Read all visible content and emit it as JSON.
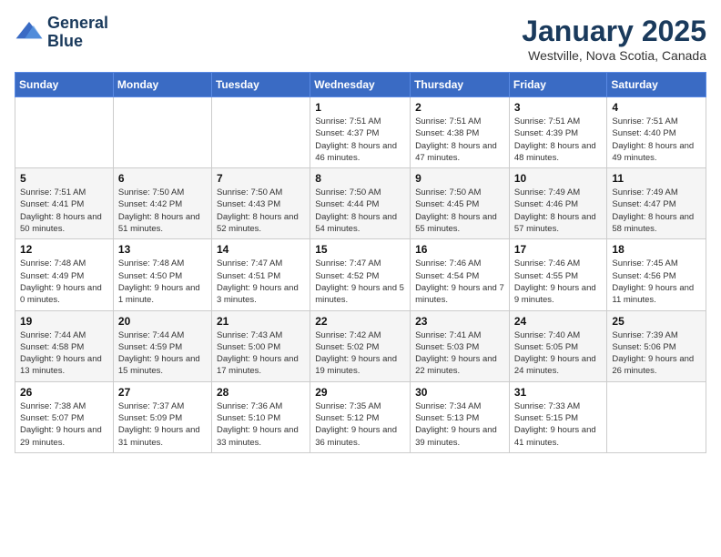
{
  "header": {
    "logo_line1": "General",
    "logo_line2": "Blue",
    "month": "January 2025",
    "location": "Westville, Nova Scotia, Canada"
  },
  "weekdays": [
    "Sunday",
    "Monday",
    "Tuesday",
    "Wednesday",
    "Thursday",
    "Friday",
    "Saturday"
  ],
  "weeks": [
    [
      {
        "day": "",
        "content": ""
      },
      {
        "day": "",
        "content": ""
      },
      {
        "day": "",
        "content": ""
      },
      {
        "day": "1",
        "content": "Sunrise: 7:51 AM\nSunset: 4:37 PM\nDaylight: 8 hours and 46 minutes."
      },
      {
        "day": "2",
        "content": "Sunrise: 7:51 AM\nSunset: 4:38 PM\nDaylight: 8 hours and 47 minutes."
      },
      {
        "day": "3",
        "content": "Sunrise: 7:51 AM\nSunset: 4:39 PM\nDaylight: 8 hours and 48 minutes."
      },
      {
        "day": "4",
        "content": "Sunrise: 7:51 AM\nSunset: 4:40 PM\nDaylight: 8 hours and 49 minutes."
      }
    ],
    [
      {
        "day": "5",
        "content": "Sunrise: 7:51 AM\nSunset: 4:41 PM\nDaylight: 8 hours and 50 minutes."
      },
      {
        "day": "6",
        "content": "Sunrise: 7:50 AM\nSunset: 4:42 PM\nDaylight: 8 hours and 51 minutes."
      },
      {
        "day": "7",
        "content": "Sunrise: 7:50 AM\nSunset: 4:43 PM\nDaylight: 8 hours and 52 minutes."
      },
      {
        "day": "8",
        "content": "Sunrise: 7:50 AM\nSunset: 4:44 PM\nDaylight: 8 hours and 54 minutes."
      },
      {
        "day": "9",
        "content": "Sunrise: 7:50 AM\nSunset: 4:45 PM\nDaylight: 8 hours and 55 minutes."
      },
      {
        "day": "10",
        "content": "Sunrise: 7:49 AM\nSunset: 4:46 PM\nDaylight: 8 hours and 57 minutes."
      },
      {
        "day": "11",
        "content": "Sunrise: 7:49 AM\nSunset: 4:47 PM\nDaylight: 8 hours and 58 minutes."
      }
    ],
    [
      {
        "day": "12",
        "content": "Sunrise: 7:48 AM\nSunset: 4:49 PM\nDaylight: 9 hours and 0 minutes."
      },
      {
        "day": "13",
        "content": "Sunrise: 7:48 AM\nSunset: 4:50 PM\nDaylight: 9 hours and 1 minute."
      },
      {
        "day": "14",
        "content": "Sunrise: 7:47 AM\nSunset: 4:51 PM\nDaylight: 9 hours and 3 minutes."
      },
      {
        "day": "15",
        "content": "Sunrise: 7:47 AM\nSunset: 4:52 PM\nDaylight: 9 hours and 5 minutes."
      },
      {
        "day": "16",
        "content": "Sunrise: 7:46 AM\nSunset: 4:54 PM\nDaylight: 9 hours and 7 minutes."
      },
      {
        "day": "17",
        "content": "Sunrise: 7:46 AM\nSunset: 4:55 PM\nDaylight: 9 hours and 9 minutes."
      },
      {
        "day": "18",
        "content": "Sunrise: 7:45 AM\nSunset: 4:56 PM\nDaylight: 9 hours and 11 minutes."
      }
    ],
    [
      {
        "day": "19",
        "content": "Sunrise: 7:44 AM\nSunset: 4:58 PM\nDaylight: 9 hours and 13 minutes."
      },
      {
        "day": "20",
        "content": "Sunrise: 7:44 AM\nSunset: 4:59 PM\nDaylight: 9 hours and 15 minutes."
      },
      {
        "day": "21",
        "content": "Sunrise: 7:43 AM\nSunset: 5:00 PM\nDaylight: 9 hours and 17 minutes."
      },
      {
        "day": "22",
        "content": "Sunrise: 7:42 AM\nSunset: 5:02 PM\nDaylight: 9 hours and 19 minutes."
      },
      {
        "day": "23",
        "content": "Sunrise: 7:41 AM\nSunset: 5:03 PM\nDaylight: 9 hours and 22 minutes."
      },
      {
        "day": "24",
        "content": "Sunrise: 7:40 AM\nSunset: 5:05 PM\nDaylight: 9 hours and 24 minutes."
      },
      {
        "day": "25",
        "content": "Sunrise: 7:39 AM\nSunset: 5:06 PM\nDaylight: 9 hours and 26 minutes."
      }
    ],
    [
      {
        "day": "26",
        "content": "Sunrise: 7:38 AM\nSunset: 5:07 PM\nDaylight: 9 hours and 29 minutes."
      },
      {
        "day": "27",
        "content": "Sunrise: 7:37 AM\nSunset: 5:09 PM\nDaylight: 9 hours and 31 minutes."
      },
      {
        "day": "28",
        "content": "Sunrise: 7:36 AM\nSunset: 5:10 PM\nDaylight: 9 hours and 33 minutes."
      },
      {
        "day": "29",
        "content": "Sunrise: 7:35 AM\nSunset: 5:12 PM\nDaylight: 9 hours and 36 minutes."
      },
      {
        "day": "30",
        "content": "Sunrise: 7:34 AM\nSunset: 5:13 PM\nDaylight: 9 hours and 39 minutes."
      },
      {
        "day": "31",
        "content": "Sunrise: 7:33 AM\nSunset: 5:15 PM\nDaylight: 9 hours and 41 minutes."
      },
      {
        "day": "",
        "content": ""
      }
    ]
  ]
}
